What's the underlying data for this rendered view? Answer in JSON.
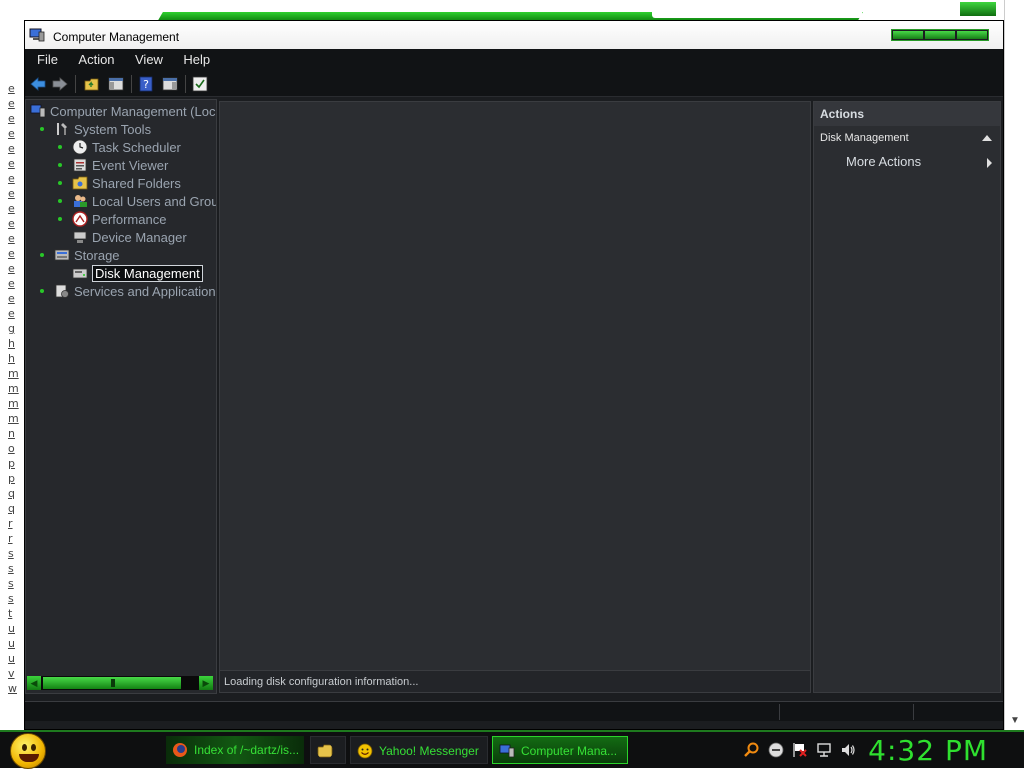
{
  "window": {
    "title": "Computer Management"
  },
  "menu": [
    {
      "label": "File"
    },
    {
      "label": "Action"
    },
    {
      "label": "View"
    },
    {
      "label": "Help"
    }
  ],
  "tree": {
    "items": [
      {
        "label": "Computer Management (Loc",
        "icon": "computer-management-icon",
        "level": 0
      },
      {
        "label": "System Tools",
        "icon": "tools-icon",
        "level": 1
      },
      {
        "label": "Task Scheduler",
        "icon": "clock-icon",
        "level": 2
      },
      {
        "label": "Event Viewer",
        "icon": "event-viewer-icon",
        "level": 2
      },
      {
        "label": "Shared Folders",
        "icon": "shared-folder-icon",
        "level": 2
      },
      {
        "label": "Local Users and Grou",
        "icon": "users-icon",
        "level": 2
      },
      {
        "label": "Performance",
        "icon": "performance-icon",
        "level": 2
      },
      {
        "label": "Device Manager",
        "icon": "device-manager-icon",
        "level": 2
      },
      {
        "label": "Storage",
        "icon": "storage-icon",
        "level": 1
      },
      {
        "label": "Disk Management",
        "icon": "disk-icon",
        "level": 2,
        "selected": true
      },
      {
        "label": "Services and Applications",
        "icon": "services-icon",
        "level": 1
      }
    ]
  },
  "center": {
    "status": "Loading disk configuration information..."
  },
  "actions": {
    "header": "Actions",
    "section": "Disk Management",
    "items": [
      {
        "label": "More Actions"
      }
    ]
  },
  "taskbar": {
    "tasks": [
      {
        "label": "Index of /~dartz/is...",
        "icon": "firefox-icon"
      },
      {
        "label": "",
        "icon": "folder-icon"
      },
      {
        "label": "Yahoo! Messenger",
        "icon": "yahoo-messenger-icon"
      },
      {
        "label": "Computer Mana...",
        "icon": "computer-management-icon"
      }
    ],
    "clock": "4:32 PM"
  },
  "sidebar_letters": [
    "e",
    "e",
    "e",
    "e",
    "e",
    "e",
    "e",
    "e",
    "e",
    "e",
    "e",
    "e",
    "e",
    "e",
    "e",
    "e",
    "g",
    "h",
    "h",
    "m",
    "m",
    "m",
    "m",
    "n",
    "o",
    "p",
    "p",
    "q",
    "q",
    "r",
    "r",
    "s",
    "s",
    "s",
    "s",
    "t",
    "u",
    "u",
    "u",
    "v",
    "w"
  ],
  "colors": {
    "accent": "#2fe02f",
    "window_bg": "#1b1d20",
    "pane_bg": "#2b2d31"
  }
}
